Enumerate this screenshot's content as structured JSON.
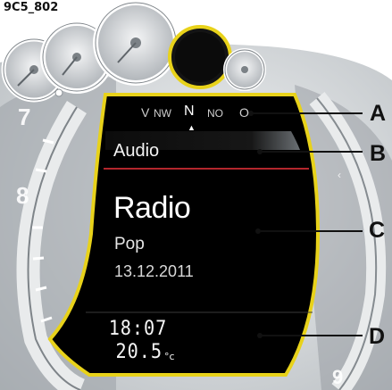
{
  "figure_code": "9C5_802",
  "compass": {
    "left_edge": "V",
    "northwest": "NW",
    "north": "N",
    "northeast": "NO",
    "right_edge": "O",
    "heading_marker": "▲"
  },
  "menu": {
    "header": "Audio",
    "title": "Radio",
    "subtitle": "Pop",
    "date": "13.12.2011"
  },
  "status": {
    "time": "18:07",
    "temperature": "20.5",
    "temperature_unit": "°c"
  },
  "callouts": [
    "A",
    "B",
    "C",
    "D"
  ],
  "colors": {
    "display_background": "#000000",
    "display_rim": "#e8d21a",
    "divider_accent": "#b3262c",
    "gauge_face": "#d7dadd"
  }
}
